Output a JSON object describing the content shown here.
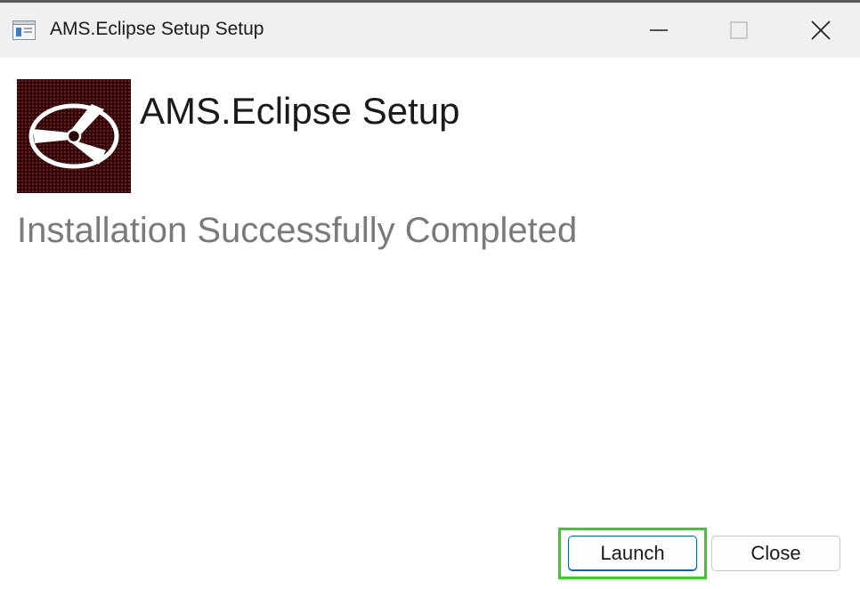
{
  "window": {
    "title": "AMS.Eclipse Setup Setup",
    "controls": [
      "minimize-icon",
      "maximize-icon",
      "close-icon"
    ]
  },
  "header": {
    "product_name": "AMS.Eclipse Setup",
    "logo_icon": "disc-icon"
  },
  "status": {
    "message": "Installation Successfully Completed"
  },
  "buttons": {
    "launch_label": "Launch",
    "close_label": "Close"
  },
  "colors": {
    "focus_highlight": "#2fd31c",
    "default_button_border": "#0067c0",
    "status_text": "#7a7a7a",
    "logo_background": "#2c0808"
  }
}
